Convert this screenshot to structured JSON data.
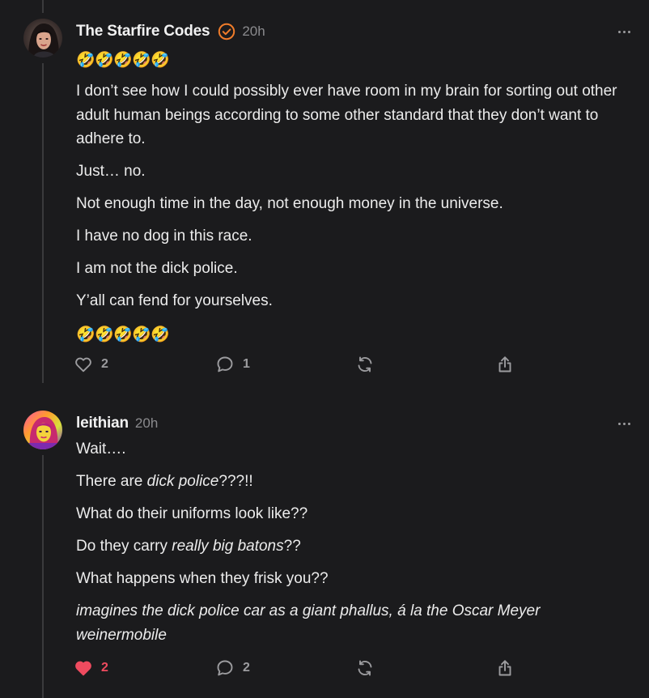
{
  "posts": [
    {
      "author": "The Starfire Codes",
      "verified": true,
      "time": "20h",
      "icon_menu": "more-horizontal-icon",
      "emoji_top": [
        "🤣",
        "🤣",
        "🤣",
        "🤣",
        "🤣"
      ],
      "paragraphs": [
        "I don’t see how I could possibly ever have room in my brain for sorting out other adult human beings according to some other standard that they don’t want to adhere to.",
        "Just… no.",
        "Not enough time in the day, not enough money in the universe.",
        "I have no dog in this race.",
        "I am not the dick police.",
        "Y’all can fend for yourselves."
      ],
      "emoji_bottom": [
        "🤣",
        "🤣",
        "🤣",
        "🤣",
        "🤣"
      ],
      "actions": {
        "likes": "2",
        "replies": "1",
        "liked": false
      }
    },
    {
      "author": "leithian",
      "verified": false,
      "time": "20h",
      "icon_menu": "more-horizontal-icon",
      "paragraphs": [
        {
          "plain": "Wait…."
        },
        {
          "before": "There are ",
          "italic": "dick police",
          "after": "???!!"
        },
        {
          "plain": "What do their uniforms look like??"
        },
        {
          "before": "Do they carry ",
          "italic": "really big batons",
          "after": "??"
        },
        {
          "plain": "What happens when they frisk you??"
        },
        {
          "italic_full": "imagines the dick police car as a giant phallus, á la the Oscar Meyer weinermobile"
        }
      ],
      "actions": {
        "likes": "2",
        "replies": "2",
        "liked": true
      }
    }
  ],
  "colors": {
    "background": "#1b1b1d",
    "text": "#ececec",
    "muted": "#8b8b8e",
    "verified": "#f07c2a",
    "liked": "#ef4b5f"
  }
}
